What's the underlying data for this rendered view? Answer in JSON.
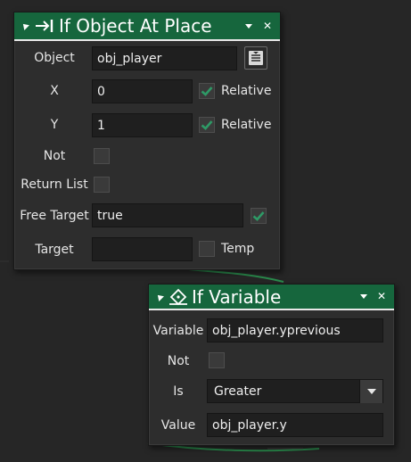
{
  "colors": {
    "header_green": "#16663d",
    "background": "#262626",
    "panel": "#2d2d2d",
    "check_green": "#2e9a66"
  },
  "node1": {
    "title": "If Object At Place",
    "icon": "arrow-to-bar-icon",
    "fields": {
      "object": {
        "label": "Object",
        "value": "obj_player"
      },
      "x": {
        "label": "X",
        "value": "0",
        "checked": true,
        "check_label": "Relative"
      },
      "y": {
        "label": "Y",
        "value": "1",
        "checked": true,
        "check_label": "Relative"
      },
      "not": {
        "label": "Not",
        "checked": false
      },
      "return_list": {
        "label": "Return List",
        "checked": false
      },
      "free_target": {
        "label": "Free Target",
        "value": "true",
        "checked": true
      },
      "target": {
        "label": "Target",
        "value": "",
        "checked": false,
        "check_label": "Temp"
      }
    }
  },
  "node2": {
    "title": "If Variable",
    "icon": "variable-node-icon",
    "fields": {
      "variable": {
        "label": "Variable",
        "value": "obj_player.yprevious"
      },
      "not": {
        "label": "Not",
        "checked": false
      },
      "is": {
        "label": "Is",
        "value": "Greater"
      },
      "value": {
        "label": "Value",
        "value": "obj_player.y"
      }
    }
  }
}
